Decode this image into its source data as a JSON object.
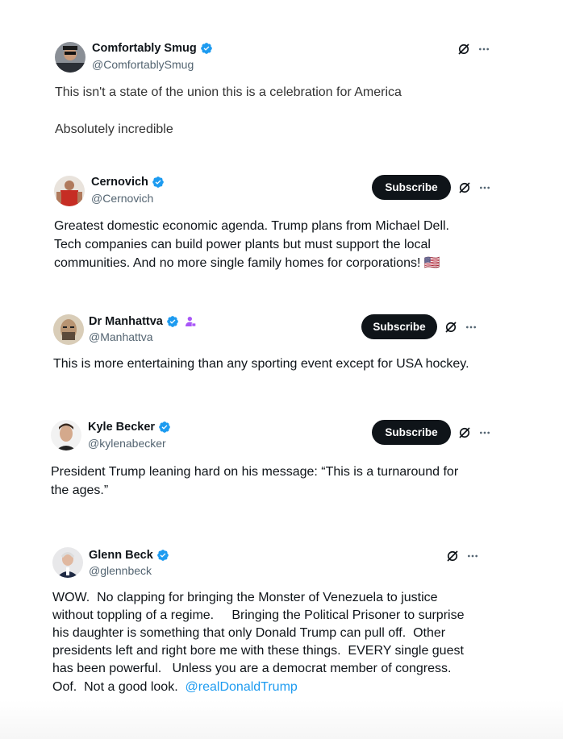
{
  "colors": {
    "verified": "#1d9bf0",
    "subscribe_bg": "#0f1419",
    "mention": "#1d9bf0",
    "affiliate": "#a855f7"
  },
  "posts": [
    {
      "name": "Comfortably Smug",
      "handle": "@ComfortablySmug",
      "verified": true,
      "subscribe": "",
      "text_lines": [
        "This isn't a state of the union this is a celebration for America",
        "",
        "Absolutely incredible"
      ],
      "icons": [
        "grok-icon",
        "more-icon"
      ]
    },
    {
      "name": "Cernovich",
      "handle": "@Cernovich",
      "verified": true,
      "subscribe": "Subscribe",
      "text_lines": [
        "Greatest domestic economic agenda. Trump plans from Michael Dell.",
        "Tech companies can build power plants but must support the local",
        "communities. And no more single family homes for corporations! 🇺🇸"
      ],
      "icons": [
        "grok-icon",
        "more-icon"
      ]
    },
    {
      "name": "Dr Manhattva",
      "handle": "@Manhattva",
      "verified": true,
      "affiliate_badge": "person-badge-icon",
      "subscribe": "Subscribe",
      "text_lines": [
        "This is more entertaining than any sporting event except for USA hockey."
      ],
      "icons": [
        "grok-icon",
        "more-icon"
      ]
    },
    {
      "name": "Kyle Becker",
      "handle": "@kylenabecker",
      "verified": true,
      "subscribe": "Subscribe",
      "text_lines": [
        "President Trump leaning hard on his message: “This is a turnaround for",
        "the ages.”"
      ],
      "icons": [
        "grok-icon",
        "more-icon"
      ]
    },
    {
      "name": "Glenn Beck",
      "handle": "@glennbeck",
      "verified": true,
      "subscribe": "",
      "text_lines": [
        "WOW.  No clapping for bringing the Monster of Venezuela to justice",
        "without toppling of a regime.     Bringing the Political Prisoner to surprise",
        "his daughter is something that only Donald Trump can pull off.  Other",
        "presidents left and right bore me with these things.  EVERY single guest",
        "has been powerful.   Unless you are a democrat member of congress.",
        "Oof.  Not a good look.  "
      ],
      "mention": "@realDonaldTrump",
      "icons": [
        "grok-icon",
        "more-icon"
      ]
    }
  ]
}
